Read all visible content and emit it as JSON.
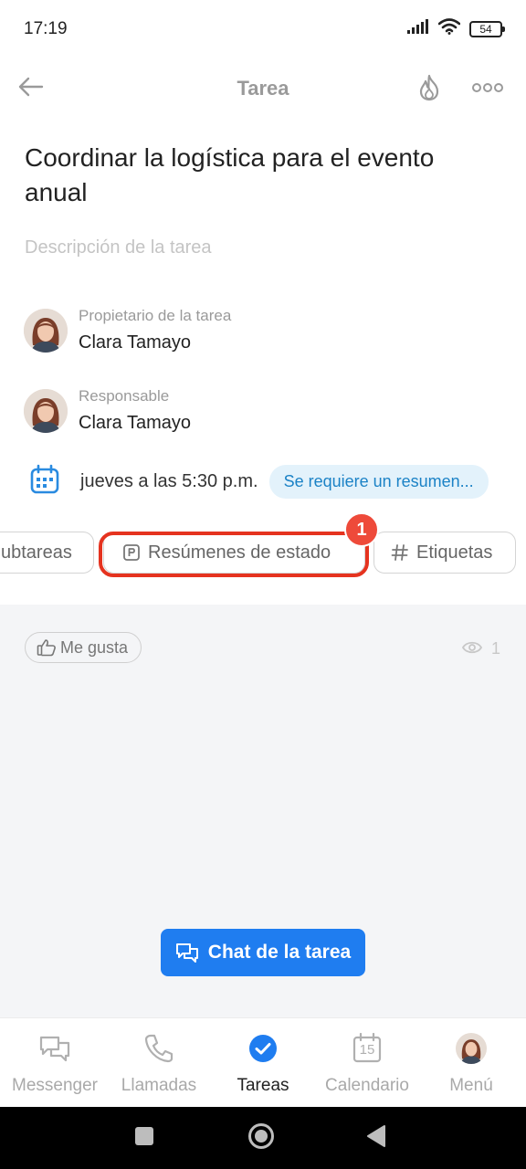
{
  "status_bar": {
    "time": "17:19",
    "battery": "54"
  },
  "header": {
    "title": "Tarea"
  },
  "task": {
    "title": "Coordinar la logística para el evento anual",
    "description_placeholder": "Descripción de la tarea"
  },
  "owner": {
    "label": "Propietario de la tarea",
    "name": "Clara Tamayo"
  },
  "responsible": {
    "label": "Responsable",
    "name": "Clara Tamayo"
  },
  "deadline": {
    "text": "jueves a las 5:30 p.m.",
    "badge": "Se requiere un resumen..."
  },
  "chips": {
    "subtasks": "ubtareas",
    "status_summaries": "Resúmenes de estado",
    "tags": "Etiquetas",
    "highlight_number": "1"
  },
  "feed": {
    "like_label": "Me gusta",
    "views": "1"
  },
  "chat_button": {
    "label": "Chat de la tarea"
  },
  "bottom_nav": {
    "items": [
      {
        "label": "Messenger"
      },
      {
        "label": "Llamadas"
      },
      {
        "label": "Tareas"
      },
      {
        "label": "Calendario",
        "day": "15"
      },
      {
        "label": "Menú"
      }
    ]
  },
  "colors": {
    "accent": "#1f7df0",
    "highlight": "#e5331f",
    "badge_bg": "#e3f2fb",
    "badge_text": "#1b82c6"
  }
}
